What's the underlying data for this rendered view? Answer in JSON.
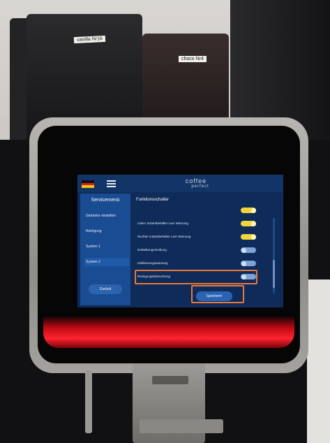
{
  "hopper_labels": [
    "vanilla Nr16",
    "choco Nr4"
  ],
  "screen": {
    "flag_colors": [
      "#111111",
      "#d2232a",
      "#f1c40f"
    ],
    "brand_top": "coffee",
    "brand_bottom": "perfect",
    "corner_line1": "",
    "corner_line2": "",
    "sidebar": {
      "title": "Servicemenü",
      "items": [
        {
          "label": "Getränke einstellen",
          "active": false
        },
        {
          "label": "Reinigung",
          "active": false
        },
        {
          "label": "System 1",
          "active": false
        },
        {
          "label": "System 2",
          "active": true
        }
      ],
      "back_label": "Zurück"
    },
    "content": {
      "title": "Funktionsschalter",
      "rows": [
        {
          "label": "",
          "state": "on"
        },
        {
          "label": "Linker Instantbehälter Leer Warnung",
          "state": "on"
        },
        {
          "label": "Rechter Instantbehälter Leer Warnung",
          "state": "on"
        },
        {
          "label": "Entkalkungsmeldung",
          "state": "off"
        },
        {
          "label": "Kalibrierungswarnung",
          "state": "off"
        },
        {
          "label": "Reinigungsbeleuchtung",
          "state": "off",
          "highlighted": true
        }
      ],
      "save_label": "Speichern"
    },
    "colors": {
      "screen_bg": "#0f2b5a",
      "sidebar_bg": "#1a4c93",
      "toggle_on": "#f2d43c",
      "toggle_off": "#7da2d6",
      "highlight": "#e8793a"
    }
  }
}
